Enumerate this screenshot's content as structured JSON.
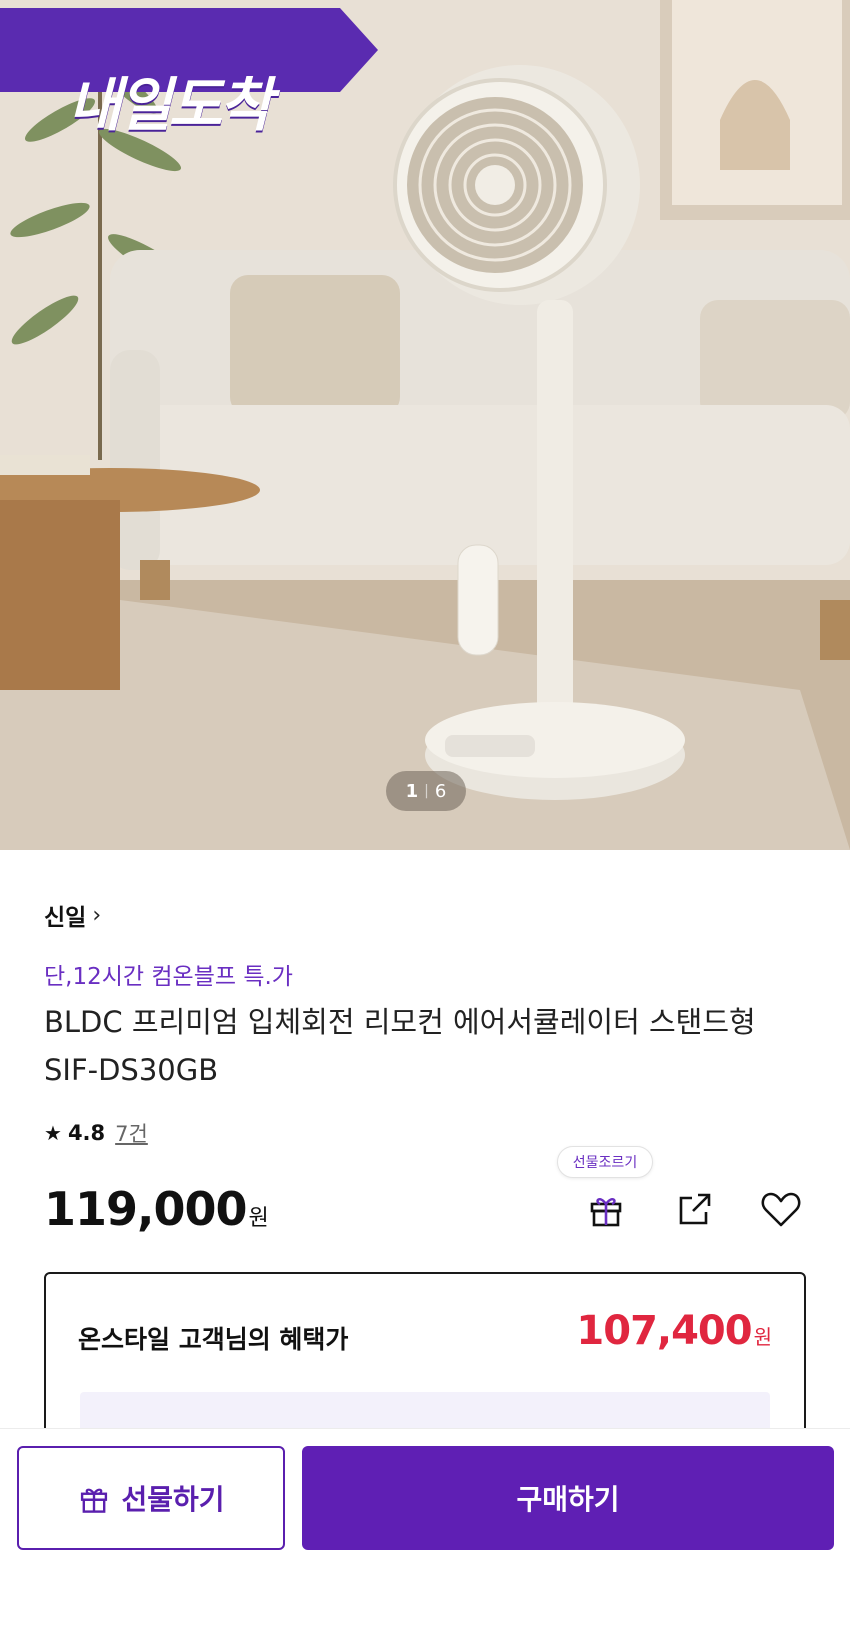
{
  "hero": {
    "badge_text": "내일도착",
    "pager_current": "1",
    "pager_total": "6",
    "image_subject": "standing air circulator fan in living room"
  },
  "product": {
    "brand": "신일",
    "promo": "단,12시간 컴온블프 특.가",
    "title": "BLDC 프리미엄 입체회전 리모컨 에어서큘레이터 스탠드형 SIF-DS30GB",
    "rating": "4.8",
    "review_count": "7건",
    "price": "119,000",
    "price_unit": "원"
  },
  "actions": {
    "gift_tooltip": "선물조르기",
    "icons": [
      "gift-icon",
      "share-icon",
      "heart-icon"
    ]
  },
  "benefit": {
    "label": "온스타일 고객님의 혜택가",
    "price": "107,400",
    "price_unit": "원"
  },
  "bottom_bar": {
    "gift_label": "선물하기",
    "buy_label": "구매하기"
  },
  "colors": {
    "brand_purple": "#5f1fb4",
    "promo_purple": "#6a2fc2",
    "benefit_red": "#e0263f"
  }
}
